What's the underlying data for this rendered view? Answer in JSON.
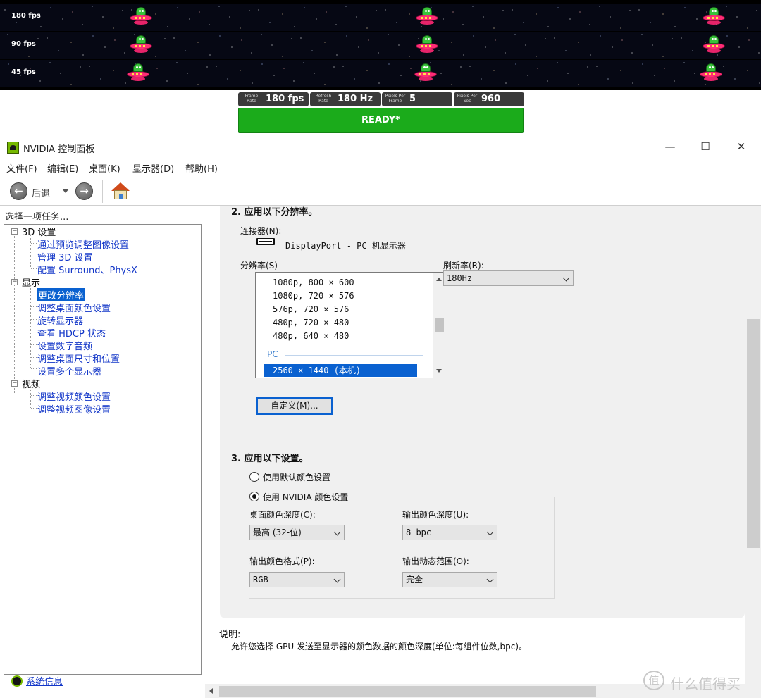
{
  "strips": [
    {
      "label": "180 fps"
    },
    {
      "label": "90 fps"
    },
    {
      "label": "45 fps"
    }
  ],
  "status": {
    "frame_rate": {
      "caption": "Frame Rate",
      "value": "180 fps"
    },
    "refresh_rate": {
      "caption": "Refresh Rate",
      "value": "180 Hz"
    },
    "pixels_per_frame": {
      "caption": "Pixels Per Frame",
      "value": "5"
    },
    "pixels_per_sec": {
      "caption": "Pixels Per Sec",
      "value": "960"
    },
    "ready": "READY*"
  },
  "window": {
    "title": "NVIDIA 控制面板",
    "controls": {
      "minimize": "—",
      "maximize": "☐",
      "close": "✕"
    },
    "menu": [
      "文件(F)",
      "编辑(E)",
      "桌面(K)",
      "显示器(D)",
      "帮助(H)"
    ],
    "toolbar": {
      "back": "后退"
    }
  },
  "left": {
    "header": "选择一项任务...",
    "groups": [
      {
        "label": "3D 设置",
        "items": [
          "通过预览调整图像设置",
          "管理 3D 设置",
          "配置 Surround、PhysX"
        ]
      },
      {
        "label": "显示",
        "items": [
          "更改分辨率",
          "调整桌面颜色设置",
          "旋转显示器",
          "查看 HDCP 状态",
          "设置数字音频",
          "调整桌面尺寸和位置",
          "设置多个显示器"
        ]
      },
      {
        "label": "视频",
        "items": [
          "调整视频颜色设置",
          "调整视频图像设置"
        ]
      }
    ],
    "selected": "更改分辨率",
    "sysinfo": "系统信息"
  },
  "main": {
    "section2": "2. 应用以下分辨率。",
    "connector_label": "连接器(N):",
    "connector_value": "DisplayPort - PC 机显示器",
    "resolution_label": "分辨率(S)",
    "resolutions": [
      "1080p, 800 × 600",
      "1080p, 720 × 576",
      "576p, 720 × 576",
      "480p, 720 × 480",
      "480p, 640 × 480"
    ],
    "group_pc": "PC",
    "selected_resolution": "2560 × 1440 (本机)",
    "refresh_label": "刷新率(R):",
    "refresh_value": "180Hz",
    "custom_button": "自定义(M)...",
    "section3": "3. 应用以下设置。",
    "radio_default": "使用默认颜色设置",
    "radio_nvidia": "使用 NVIDIA 颜色设置",
    "desktop_depth_label": "桌面颜色深度(C):",
    "desktop_depth_value": "最高 (32-位)",
    "output_depth_label": "输出颜色深度(U):",
    "output_depth_value": "8 bpc",
    "output_format_label": "输出颜色格式(P):",
    "output_format_value": "RGB",
    "dynamic_range_label": "输出动态范围(O):",
    "dynamic_range_value": "完全",
    "desc_title": "说明:",
    "desc_body": "允许您选择 GPU 发送至显示器的颜色数据的颜色深度(单位:每组件位数,bpc)。"
  },
  "watermark": {
    "text": "什么值得买",
    "icon": "值"
  }
}
